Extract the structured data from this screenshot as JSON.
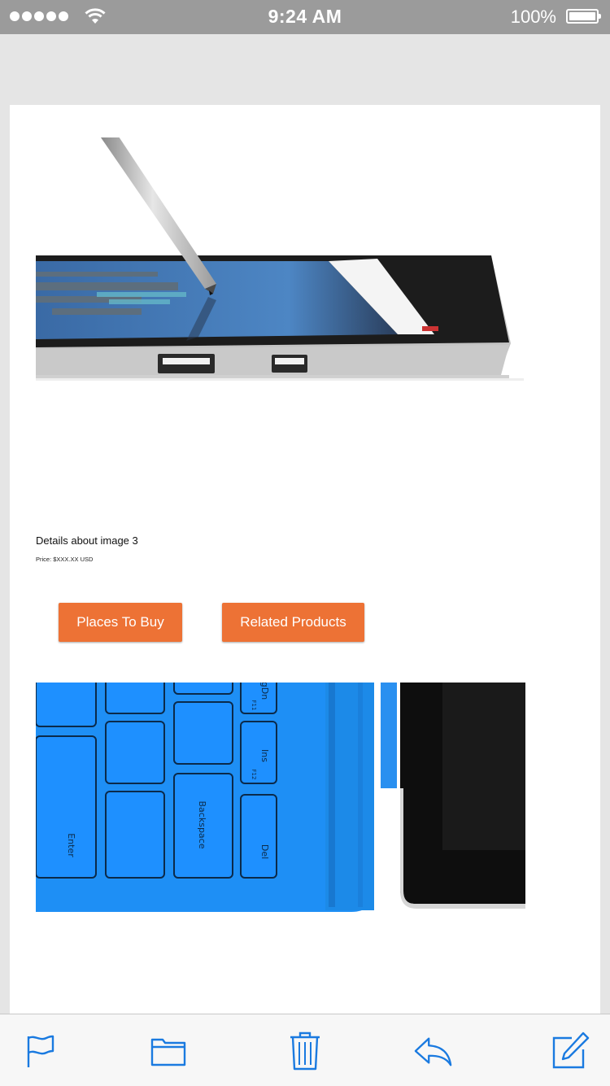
{
  "status_bar": {
    "time": "9:24 AM",
    "battery": "100%",
    "signal_icon": "signal-dots-icon",
    "wifi_icon": "wifi-icon",
    "battery_icon": "battery-full-icon"
  },
  "content": {
    "image_1_alt": "Tablet with stylus pen",
    "details_title": "Details about image 3",
    "price": "Price: $XXX.XX USD",
    "buttons": {
      "places_to_buy": "Places To Buy",
      "related_products": "Related Products"
    },
    "image_2_alt": "Blue type cover keyboard next to tablet",
    "keyboard_keys": {
      "enter": "Enter",
      "backspace": "Backspace",
      "del": "Del",
      "ins": "Ins",
      "f12": "F12",
      "f11": "F11",
      "pgdn": "gDn"
    }
  },
  "toolbar": {
    "items": [
      "flag-icon",
      "folder-icon",
      "trash-icon",
      "reply-icon",
      "compose-icon"
    ]
  },
  "colors": {
    "accent": "#ed7235",
    "toolbar_icon": "#1a7ae0",
    "keyboard_blue": "#1e90ff",
    "status_bar": "#9b9b9b"
  }
}
